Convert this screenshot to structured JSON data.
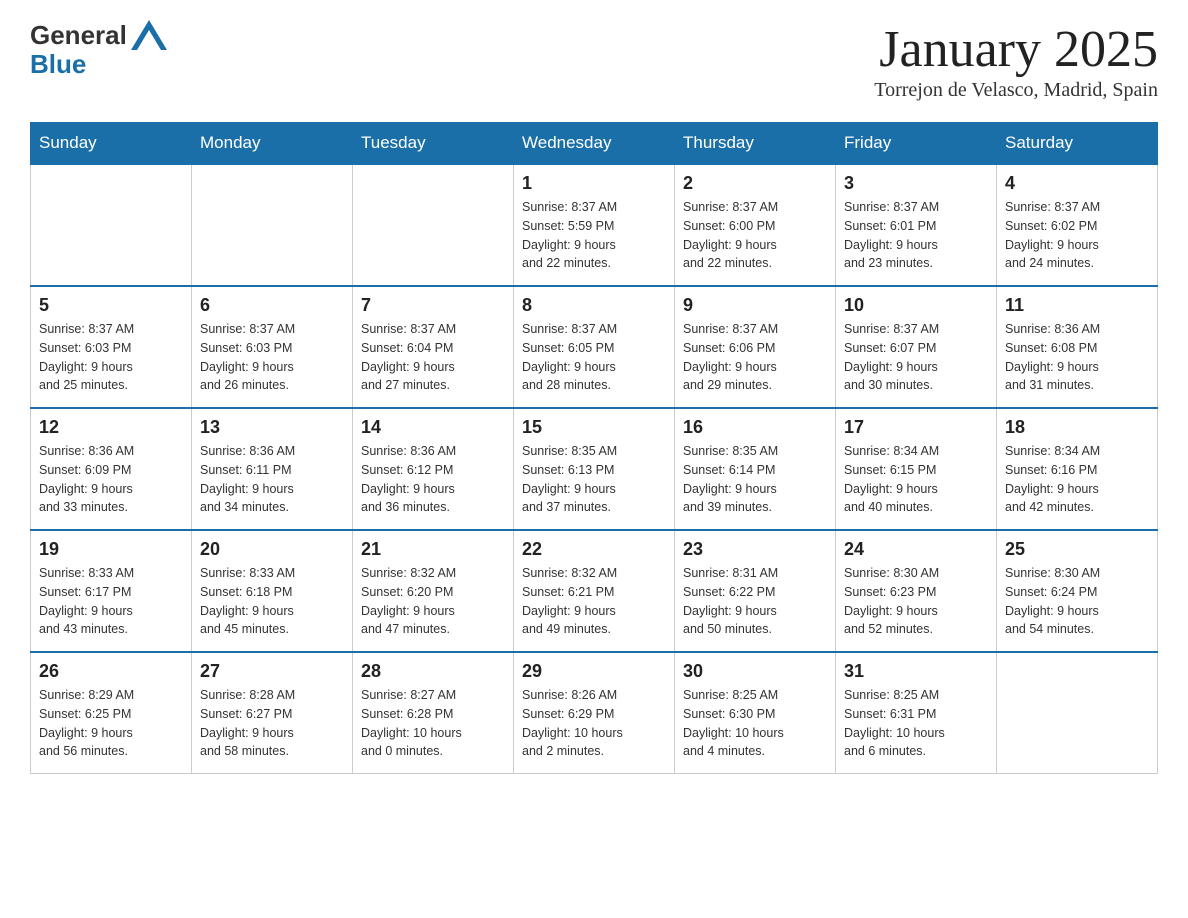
{
  "header": {
    "logo_general": "General",
    "logo_blue": "Blue",
    "month_title": "January 2025",
    "location": "Torrejon de Velasco, Madrid, Spain"
  },
  "days_of_week": [
    "Sunday",
    "Monday",
    "Tuesday",
    "Wednesday",
    "Thursday",
    "Friday",
    "Saturday"
  ],
  "weeks": [
    [
      {
        "day": "",
        "info": ""
      },
      {
        "day": "",
        "info": ""
      },
      {
        "day": "",
        "info": ""
      },
      {
        "day": "1",
        "info": "Sunrise: 8:37 AM\nSunset: 5:59 PM\nDaylight: 9 hours\nand 22 minutes."
      },
      {
        "day": "2",
        "info": "Sunrise: 8:37 AM\nSunset: 6:00 PM\nDaylight: 9 hours\nand 22 minutes."
      },
      {
        "day": "3",
        "info": "Sunrise: 8:37 AM\nSunset: 6:01 PM\nDaylight: 9 hours\nand 23 minutes."
      },
      {
        "day": "4",
        "info": "Sunrise: 8:37 AM\nSunset: 6:02 PM\nDaylight: 9 hours\nand 24 minutes."
      }
    ],
    [
      {
        "day": "5",
        "info": "Sunrise: 8:37 AM\nSunset: 6:03 PM\nDaylight: 9 hours\nand 25 minutes."
      },
      {
        "day": "6",
        "info": "Sunrise: 8:37 AM\nSunset: 6:03 PM\nDaylight: 9 hours\nand 26 minutes."
      },
      {
        "day": "7",
        "info": "Sunrise: 8:37 AM\nSunset: 6:04 PM\nDaylight: 9 hours\nand 27 minutes."
      },
      {
        "day": "8",
        "info": "Sunrise: 8:37 AM\nSunset: 6:05 PM\nDaylight: 9 hours\nand 28 minutes."
      },
      {
        "day": "9",
        "info": "Sunrise: 8:37 AM\nSunset: 6:06 PM\nDaylight: 9 hours\nand 29 minutes."
      },
      {
        "day": "10",
        "info": "Sunrise: 8:37 AM\nSunset: 6:07 PM\nDaylight: 9 hours\nand 30 minutes."
      },
      {
        "day": "11",
        "info": "Sunrise: 8:36 AM\nSunset: 6:08 PM\nDaylight: 9 hours\nand 31 minutes."
      }
    ],
    [
      {
        "day": "12",
        "info": "Sunrise: 8:36 AM\nSunset: 6:09 PM\nDaylight: 9 hours\nand 33 minutes."
      },
      {
        "day": "13",
        "info": "Sunrise: 8:36 AM\nSunset: 6:11 PM\nDaylight: 9 hours\nand 34 minutes."
      },
      {
        "day": "14",
        "info": "Sunrise: 8:36 AM\nSunset: 6:12 PM\nDaylight: 9 hours\nand 36 minutes."
      },
      {
        "day": "15",
        "info": "Sunrise: 8:35 AM\nSunset: 6:13 PM\nDaylight: 9 hours\nand 37 minutes."
      },
      {
        "day": "16",
        "info": "Sunrise: 8:35 AM\nSunset: 6:14 PM\nDaylight: 9 hours\nand 39 minutes."
      },
      {
        "day": "17",
        "info": "Sunrise: 8:34 AM\nSunset: 6:15 PM\nDaylight: 9 hours\nand 40 minutes."
      },
      {
        "day": "18",
        "info": "Sunrise: 8:34 AM\nSunset: 6:16 PM\nDaylight: 9 hours\nand 42 minutes."
      }
    ],
    [
      {
        "day": "19",
        "info": "Sunrise: 8:33 AM\nSunset: 6:17 PM\nDaylight: 9 hours\nand 43 minutes."
      },
      {
        "day": "20",
        "info": "Sunrise: 8:33 AM\nSunset: 6:18 PM\nDaylight: 9 hours\nand 45 minutes."
      },
      {
        "day": "21",
        "info": "Sunrise: 8:32 AM\nSunset: 6:20 PM\nDaylight: 9 hours\nand 47 minutes."
      },
      {
        "day": "22",
        "info": "Sunrise: 8:32 AM\nSunset: 6:21 PM\nDaylight: 9 hours\nand 49 minutes."
      },
      {
        "day": "23",
        "info": "Sunrise: 8:31 AM\nSunset: 6:22 PM\nDaylight: 9 hours\nand 50 minutes."
      },
      {
        "day": "24",
        "info": "Sunrise: 8:30 AM\nSunset: 6:23 PM\nDaylight: 9 hours\nand 52 minutes."
      },
      {
        "day": "25",
        "info": "Sunrise: 8:30 AM\nSunset: 6:24 PM\nDaylight: 9 hours\nand 54 minutes."
      }
    ],
    [
      {
        "day": "26",
        "info": "Sunrise: 8:29 AM\nSunset: 6:25 PM\nDaylight: 9 hours\nand 56 minutes."
      },
      {
        "day": "27",
        "info": "Sunrise: 8:28 AM\nSunset: 6:27 PM\nDaylight: 9 hours\nand 58 minutes."
      },
      {
        "day": "28",
        "info": "Sunrise: 8:27 AM\nSunset: 6:28 PM\nDaylight: 10 hours\nand 0 minutes."
      },
      {
        "day": "29",
        "info": "Sunrise: 8:26 AM\nSunset: 6:29 PM\nDaylight: 10 hours\nand 2 minutes."
      },
      {
        "day": "30",
        "info": "Sunrise: 8:25 AM\nSunset: 6:30 PM\nDaylight: 10 hours\nand 4 minutes."
      },
      {
        "day": "31",
        "info": "Sunrise: 8:25 AM\nSunset: 6:31 PM\nDaylight: 10 hours\nand 6 minutes."
      },
      {
        "day": "",
        "info": ""
      }
    ]
  ]
}
